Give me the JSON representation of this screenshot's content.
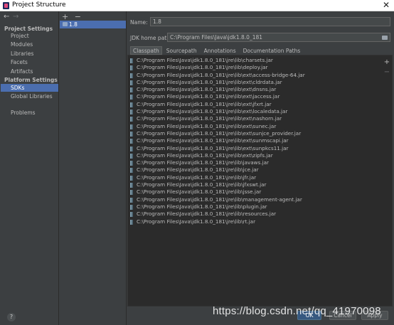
{
  "window": {
    "title": "Project Structure",
    "close_glyph": "✕"
  },
  "nav": {
    "back": "←",
    "forward": "→"
  },
  "sidebar": {
    "project_settings_heading": "Project Settings",
    "project_items": [
      "Project",
      "Modules",
      "Libraries",
      "Facets",
      "Artifacts"
    ],
    "platform_settings_heading": "Platform Settings",
    "platform_items": [
      "SDKs",
      "Global Libraries"
    ],
    "selected": "SDKs",
    "problems": "Problems"
  },
  "sdk_list": {
    "add": "+",
    "remove": "−",
    "items": [
      "1.8"
    ]
  },
  "sdk_detail": {
    "name_label": "Name:",
    "name_value": "1.8",
    "home_label": "JDK home path:",
    "home_value": "C:\\Program Files\\Java\\jdk1.8.0_181",
    "tabs": [
      "Classpath",
      "Sourcepath",
      "Annotations",
      "Documentation Paths"
    ],
    "active_tab": "Classpath",
    "panel_add": "+",
    "panel_remove": "−",
    "classpath": [
      "C:\\Program Files\\Java\\jdk1.8.0_181\\jre\\lib\\charsets.jar",
      "C:\\Program Files\\Java\\jdk1.8.0_181\\jre\\lib\\deploy.jar",
      "C:\\Program Files\\Java\\jdk1.8.0_181\\jre\\lib\\ext\\access-bridge-64.jar",
      "C:\\Program Files\\Java\\jdk1.8.0_181\\jre\\lib\\ext\\cldrdata.jar",
      "C:\\Program Files\\Java\\jdk1.8.0_181\\jre\\lib\\ext\\dnsns.jar",
      "C:\\Program Files\\Java\\jdk1.8.0_181\\jre\\lib\\ext\\jaccess.jar",
      "C:\\Program Files\\Java\\jdk1.8.0_181\\jre\\lib\\ext\\jfxrt.jar",
      "C:\\Program Files\\Java\\jdk1.8.0_181\\jre\\lib\\ext\\localedata.jar",
      "C:\\Program Files\\Java\\jdk1.8.0_181\\jre\\lib\\ext\\nashorn.jar",
      "C:\\Program Files\\Java\\jdk1.8.0_181\\jre\\lib\\ext\\sunec.jar",
      "C:\\Program Files\\Java\\jdk1.8.0_181\\jre\\lib\\ext\\sunjce_provider.jar",
      "C:\\Program Files\\Java\\jdk1.8.0_181\\jre\\lib\\ext\\sunmscapi.jar",
      "C:\\Program Files\\Java\\jdk1.8.0_181\\jre\\lib\\ext\\sunpkcs11.jar",
      "C:\\Program Files\\Java\\jdk1.8.0_181\\jre\\lib\\ext\\zipfs.jar",
      "C:\\Program Files\\Java\\jdk1.8.0_181\\jre\\lib\\javaws.jar",
      "C:\\Program Files\\Java\\jdk1.8.0_181\\jre\\lib\\jce.jar",
      "C:\\Program Files\\Java\\jdk1.8.0_181\\jre\\lib\\jfr.jar",
      "C:\\Program Files\\Java\\jdk1.8.0_181\\jre\\lib\\jfxswt.jar",
      "C:\\Program Files\\Java\\jdk1.8.0_181\\jre\\lib\\jsse.jar",
      "C:\\Program Files\\Java\\jdk1.8.0_181\\jre\\lib\\management-agent.jar",
      "C:\\Program Files\\Java\\jdk1.8.0_181\\jre\\lib\\plugin.jar",
      "C:\\Program Files\\Java\\jdk1.8.0_181\\jre\\lib\\resources.jar",
      "C:\\Program Files\\Java\\jdk1.8.0_181\\jre\\lib\\rt.jar"
    ]
  },
  "footer": {
    "help": "?",
    "ok": "OK",
    "cancel": "Cancel",
    "apply": "Apply"
  },
  "watermark": "https://blog.csdn.net/qq_41970098",
  "colors": {
    "selection": "#4b6eaf",
    "background": "#3c3f41",
    "panel": "#2b2b2b",
    "ok_button": "#365880"
  }
}
